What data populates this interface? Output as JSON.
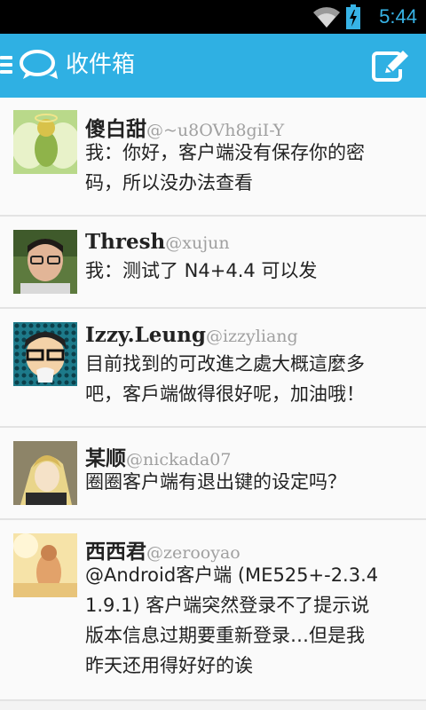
{
  "status_bar": {
    "time": "5:44",
    "wifi_icon": "wifi-icon",
    "battery_icon": "battery-charging-icon"
  },
  "app_bar": {
    "menu_icon": "menu-icon",
    "logo_icon": "chat-bubbles-icon",
    "title": "收件箱",
    "compose_icon": "compose-icon",
    "color": "#2fb0e3"
  },
  "messages": [
    {
      "name": "傻白甜",
      "handle": "@~u8OVh8giI-Y",
      "text_lines": [
        "我：你好，客户端没有保存你的密",
        "码，所以没办法查看"
      ]
    },
    {
      "name": "Thresh",
      "handle": "@xujun",
      "text_lines": [
        "我：测试了 N4+4.4 可以发"
      ]
    },
    {
      "name": "Izzy.Leung",
      "handle": "@izzyliang",
      "text_lines": [
        "目前找到的可改進之處大概這麼多",
        "吧，客戶端做得很好呢，加油哦！"
      ]
    },
    {
      "name": "某顺",
      "handle": "@nickada07",
      "text_lines": [
        "圈圈客户端有退出键的设定吗？"
      ]
    },
    {
      "name": "西西君",
      "handle": "@zerooyao",
      "text_lines": [
        "@Android客户端 (ME525+-2.3.4",
        "1.9.1) 客户端突然登录不了提示说",
        "版本信息过期要重新登录…但是我",
        "昨天还用得好好的诶"
      ]
    }
  ]
}
